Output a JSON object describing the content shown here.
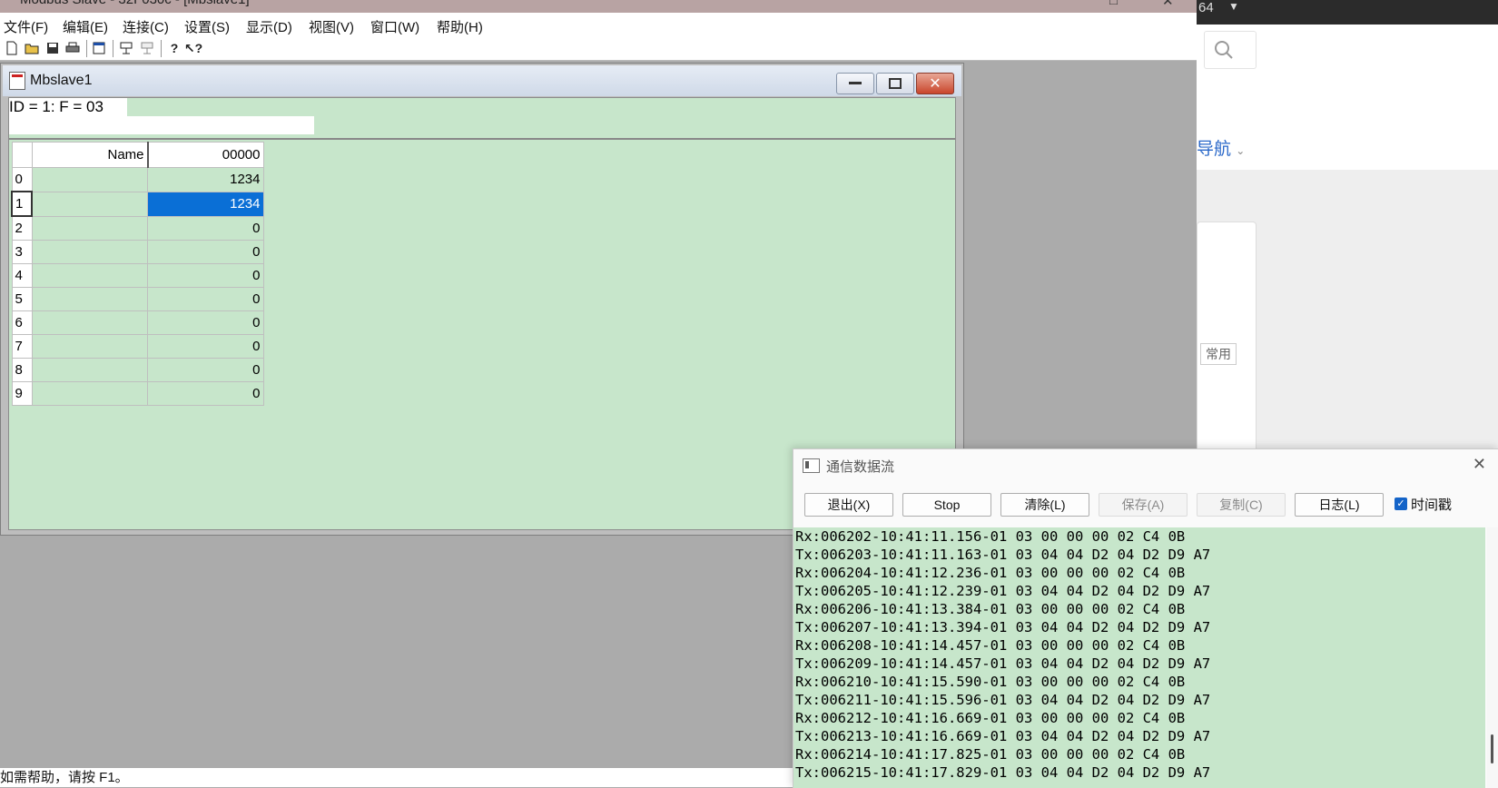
{
  "app": {
    "title": "Modbus Slave - 32F030c - Mbslave1",
    "title_visible": "Modbus Slave - 32F030c - [Mbslave1]"
  },
  "menu": [
    "文件(F)",
    "编辑(E)",
    "连接(C)",
    "设置(S)",
    "显示(D)",
    "视图(V)",
    "窗口(W)",
    "帮助(H)"
  ],
  "toolbar_icons": [
    "new-doc-icon",
    "open-folder-icon",
    "save-icon",
    "print-icon",
    "window-icon",
    "connect-icon",
    "disconnect-icon",
    "help-icon",
    "context-help-icon"
  ],
  "mdi": {
    "title": "Mbslave1",
    "status": "ID = 1: F = 03",
    "columns": {
      "name": "Name",
      "address": "00000"
    },
    "rows": [
      {
        "index": "0",
        "name": "",
        "value": "1234"
      },
      {
        "index": "1",
        "name": "",
        "value": "1234"
      },
      {
        "index": "2",
        "name": "",
        "value": "0"
      },
      {
        "index": "3",
        "name": "",
        "value": "0"
      },
      {
        "index": "4",
        "name": "",
        "value": "0"
      },
      {
        "index": "5",
        "name": "",
        "value": "0"
      },
      {
        "index": "6",
        "name": "",
        "value": "0"
      },
      {
        "index": "7",
        "name": "",
        "value": "0"
      },
      {
        "index": "8",
        "name": "",
        "value": "0"
      },
      {
        "index": "9",
        "name": "",
        "value": "0"
      }
    ],
    "selected_row": 1
  },
  "statusbar": "如需帮助，请按 F1。",
  "background_window": {
    "topbar_text": "64",
    "nav_text": "导航",
    "chip_text": "常用"
  },
  "dialog": {
    "title": "通信数据流",
    "buttons": {
      "exit": "退出(X)",
      "stop": "Stop",
      "clear": "清除(L)",
      "save": "保存(A)",
      "copy": "复制(C)",
      "log": "日志(L)"
    },
    "timestamp_label": "时间戳",
    "timestamp_checked": true,
    "lines": [
      "Rx:006202-10:41:11.156-01 03 00 00 00 02 C4 0B",
      "Tx:006203-10:41:11.163-01 03 04 04 D2 04 D2 D9 A7",
      "Rx:006204-10:41:12.236-01 03 00 00 00 02 C4 0B",
      "Tx:006205-10:41:12.239-01 03 04 04 D2 04 D2 D9 A7",
      "Rx:006206-10:41:13.384-01 03 00 00 00 02 C4 0B",
      "Tx:006207-10:41:13.394-01 03 04 04 D2 04 D2 D9 A7",
      "Rx:006208-10:41:14.457-01 03 00 00 00 02 C4 0B",
      "Tx:006209-10:41:14.457-01 03 04 04 D2 04 D2 D9 A7",
      "Rx:006210-10:41:15.590-01 03 00 00 00 02 C4 0B",
      "Tx:006211-10:41:15.596-01 03 04 04 D2 04 D2 D9 A7",
      "Rx:006212-10:41:16.669-01 03 00 00 00 02 C4 0B",
      "Tx:006213-10:41:16.669-01 03 04 04 D2 04 D2 D9 A7",
      "Rx:006214-10:41:17.825-01 03 00 00 00 02 C4 0B",
      "Tx:006215-10:41:17.829-01 03 04 04 D2 04 D2 D9 A7"
    ]
  },
  "colors": {
    "grid_bg": "#c7e6cb",
    "selection": "#0a6fd6",
    "desktop": "#ababab"
  }
}
